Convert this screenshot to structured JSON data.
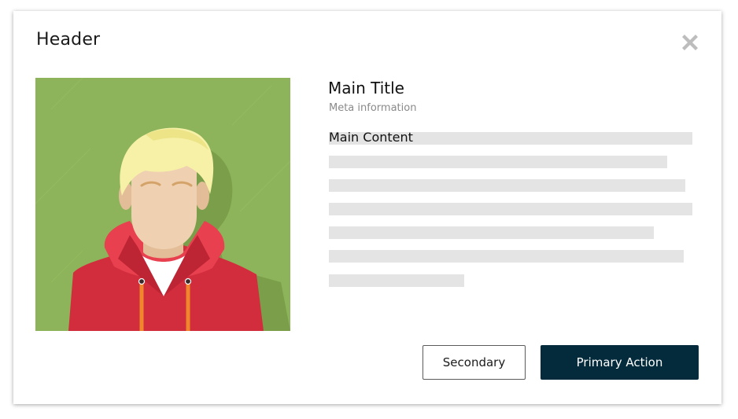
{
  "modal": {
    "header": "Header",
    "close_icon": "close-icon",
    "main_title": "Main Title",
    "meta_information": "Meta information",
    "main_content": "Main Content",
    "avatar_icon": "user-avatar-illustration"
  },
  "actions": {
    "secondary_label": "Secondary",
    "primary_label": "Primary Action"
  },
  "colors": {
    "primary_button": "#042b3c",
    "avatar_background": "#8db45a",
    "placeholder_line": "#e4e4e4",
    "close_icon": "#bdbdbd"
  }
}
